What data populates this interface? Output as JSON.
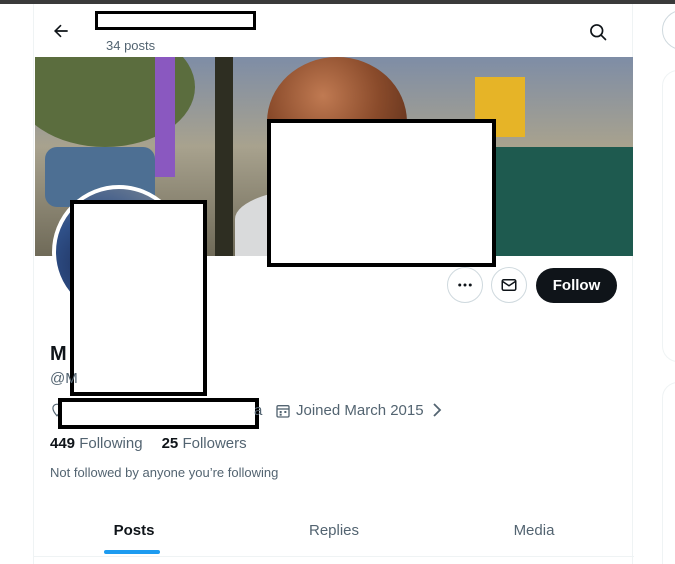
{
  "header": {
    "back_icon": "arrow-left-icon",
    "posts_count": "34 posts",
    "search_icon": "search-icon"
  },
  "actions": {
    "more_icon": "more-horizontal-icon",
    "message_icon": "mail-icon",
    "follow_label": "Follow"
  },
  "profile": {
    "display_name_fragment": "M",
    "handle_fragment": "@M",
    "location_fragment": "a",
    "joined": "Joined March 2015",
    "following_count": "449",
    "following_label": "Following",
    "followers_count": "25",
    "followers_label": "Followers",
    "followed_by": "Not followed by anyone you’re following"
  },
  "tabs": [
    {
      "label": "Posts",
      "active": true
    },
    {
      "label": "Replies",
      "active": false
    },
    {
      "label": "Media",
      "active": false
    }
  ],
  "colors": {
    "accent": "#1d9bf0",
    "text_primary": "#0f1419",
    "text_secondary": "#536471",
    "follow_bg": "#0f1419"
  }
}
